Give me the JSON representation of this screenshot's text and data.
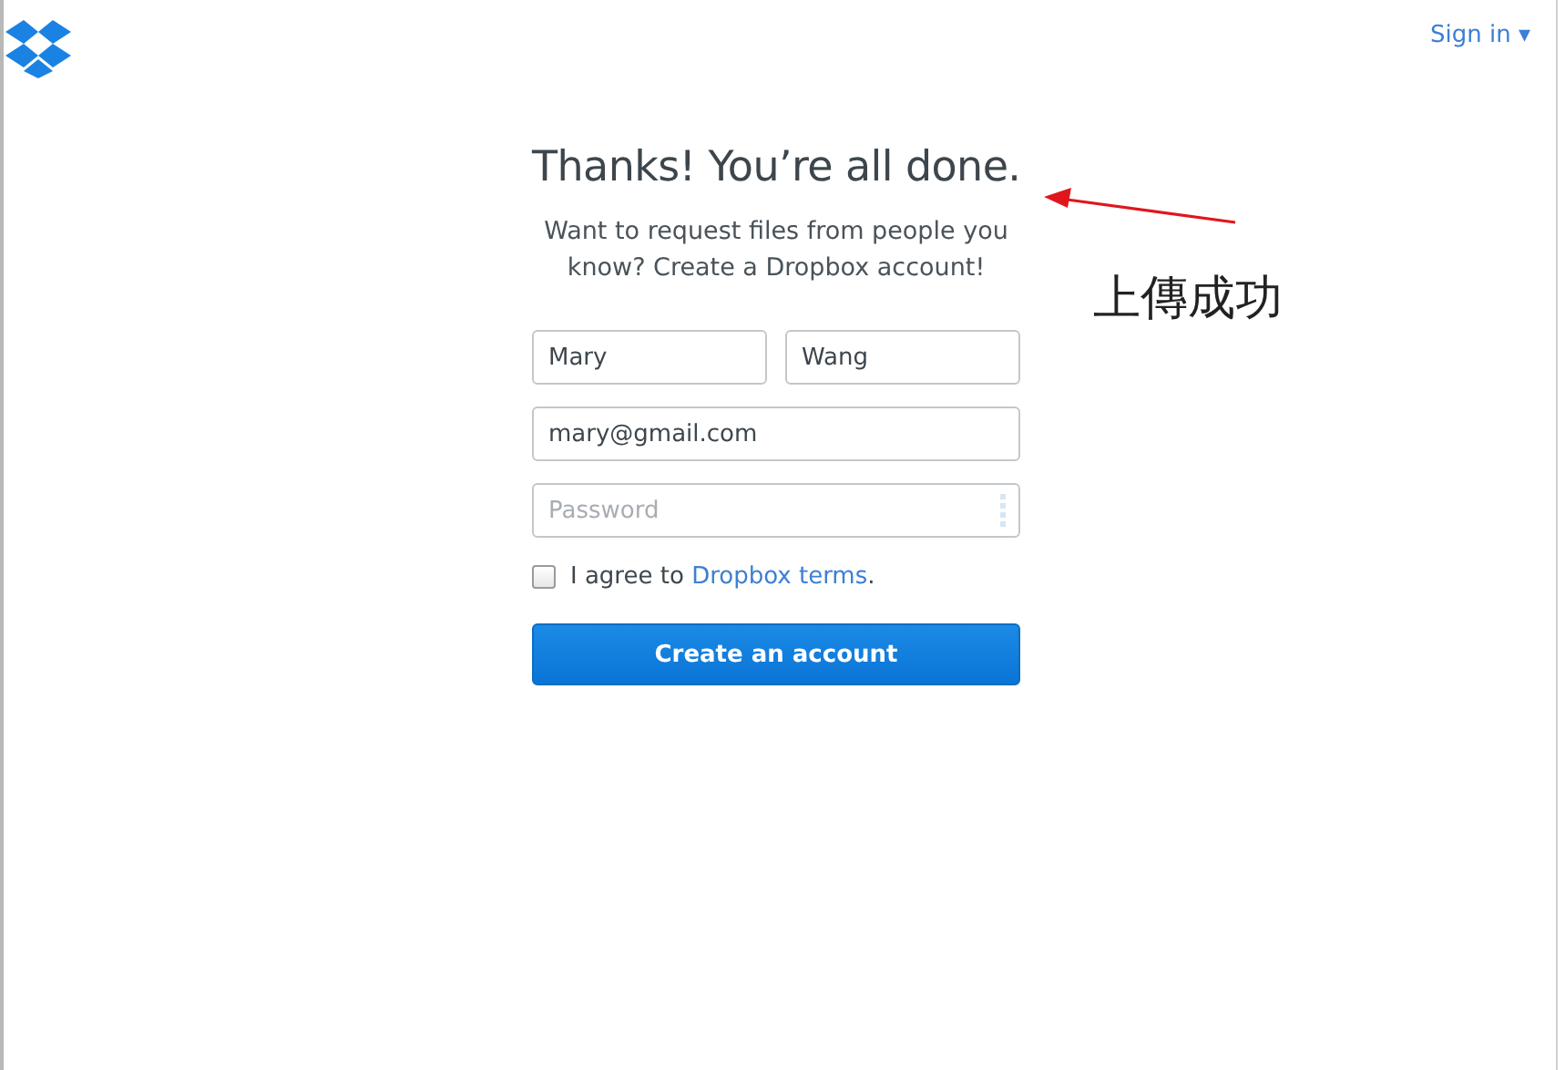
{
  "header": {
    "sign_in": "Sign in ▾"
  },
  "form": {
    "title": "Thanks! You’re all done.",
    "subtitle": "Want to request files from people you know? Create a Dropbox account!",
    "name_fields": [
      {
        "kind": "text",
        "value": "Mary"
      },
      {
        "kind": "text",
        "value": "Wang"
      }
    ],
    "fields": [
      {
        "kind": "text",
        "value": "mary@gmail.com"
      },
      {
        "kind": "password",
        "placeholder": "Password"
      }
    ],
    "agree": {
      "checked": false,
      "prefix": "I agree to ",
      "link": "Dropbox terms",
      "suffix": "."
    },
    "button": "Create an account"
  },
  "annotation": {
    "text": "上傳成功"
  }
}
